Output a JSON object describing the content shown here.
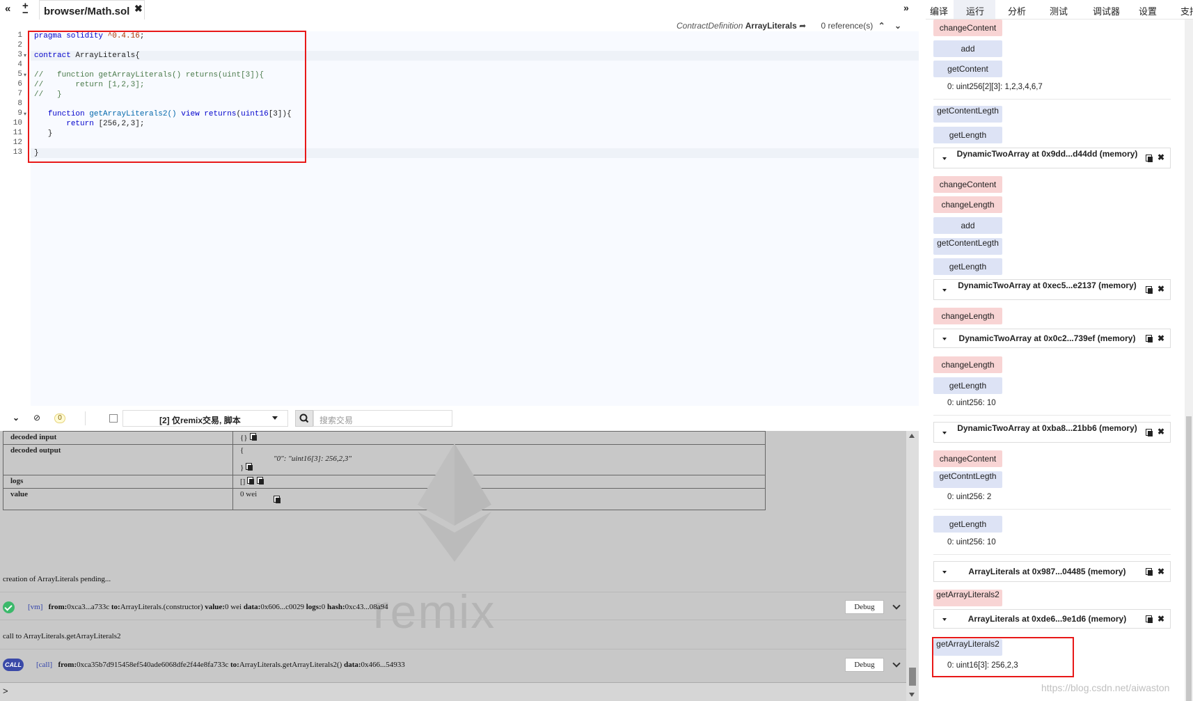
{
  "tabs": {
    "file_name": "browser/Math.sol"
  },
  "editor": {
    "ref_kind": "ContractDefinition",
    "ref_name": "ArrayLiterals",
    "ref_count": "0 reference(s)",
    "lines": [
      {
        "num": "1",
        "segments": [
          {
            "cls": "kw",
            "t": "pragma solidity "
          },
          {
            "cls": "str",
            "t": "^0.4.16"
          },
          {
            "cls": "",
            "t": ";"
          }
        ]
      },
      {
        "num": "2",
        "segments": []
      },
      {
        "num": "3",
        "segments": [
          {
            "cls": "kw",
            "t": "contract "
          },
          {
            "cls": "",
            "t": "ArrayLiterals{"
          }
        ]
      },
      {
        "num": "4",
        "segments": []
      },
      {
        "num": "5",
        "segments": [
          {
            "cls": "cm",
            "t": "//   function getArrayLiterals() returns(uint[3]){"
          }
        ]
      },
      {
        "num": "6",
        "segments": [
          {
            "cls": "cm",
            "t": "//       return [1,2,3];"
          }
        ]
      },
      {
        "num": "7",
        "segments": [
          {
            "cls": "cm",
            "t": "//   }"
          }
        ]
      },
      {
        "num": "8",
        "segments": []
      },
      {
        "num": "9",
        "segments": [
          {
            "cls": "",
            "t": "   "
          },
          {
            "cls": "kw",
            "t": "function "
          },
          {
            "cls": "fn",
            "t": "getArrayLiterals2() "
          },
          {
            "cls": "kw",
            "t": "view returns"
          },
          {
            "cls": "",
            "t": "("
          },
          {
            "cls": "kw",
            "t": "uint16"
          },
          {
            "cls": "",
            "t": "[3]){"
          }
        ]
      },
      {
        "num": "10",
        "segments": [
          {
            "cls": "",
            "t": "       "
          },
          {
            "cls": "kw",
            "t": "return "
          },
          {
            "cls": "",
            "t": "[256,2,3];"
          }
        ]
      },
      {
        "num": "11",
        "segments": [
          {
            "cls": "",
            "t": "   }"
          }
        ]
      },
      {
        "num": "12",
        "segments": []
      },
      {
        "num": "13",
        "segments": [
          {
            "cls": "",
            "t": "}"
          }
        ]
      }
    ]
  },
  "terminal": {
    "pending_count": "0",
    "filter_value": "[2] 仅remix交易, 脚本",
    "search_placeholder": "搜索交易",
    "table": {
      "decoded_input_key": "decoded input",
      "decoded_input_val": "{}",
      "decoded_output_key": "decoded output",
      "decoded_output_l1": "{",
      "decoded_output_l2": "\"0\": \"uint16[3]: 256,2,3\"",
      "decoded_output_l3": "}",
      "logs_key": "logs",
      "logs_val": "[]",
      "value_key": "value",
      "value_val": "0 wei"
    },
    "msg_pending": "creation of ArrayLiterals pending...",
    "tx1": {
      "tag": "[vm]",
      "from_k": "from:",
      "from_v": "0xca3...a733c",
      "to_k": "to:",
      "to_v": "ArrayLiterals.(constructor)",
      "value_k": "value:",
      "value_v": "0 wei",
      "data_k": "data:",
      "data_v": "0x606...c0029",
      "logs_k": "logs:",
      "logs_v": "0",
      "hash_k": "hash:",
      "hash_v": "0xc43...08a94"
    },
    "msg_call": "call to ArrayLiterals.getArrayLiterals2",
    "tx2": {
      "icon_label": "CALL",
      "tag": "[call]",
      "from_k": "from:",
      "from_v": "0xca35b7d915458ef540ade6068dfe2f44e8fa733c",
      "to_k": "to:",
      "to_v": "ArrayLiterals.getArrayLiterals2()",
      "data_k": "data:",
      "data_v": "0x466...54933"
    },
    "debug_label": "Debug",
    "watermark": "remix",
    "prompt": ">"
  },
  "right_panel": {
    "tabs": [
      "编译",
      "运行",
      "分析",
      "测试",
      "调试器",
      "设置",
      "支持"
    ],
    "active_tab": "运行",
    "btn_change_content": "changeContent",
    "btn_add": "add",
    "btn_get_content": "getContent",
    "btn_get_content_legth": "getContentLegth",
    "btn_get_length": "getLength",
    "btn_change_length": "changeLength",
    "btn_get_contnt_legth": "getContntLegth",
    "btn_get_array_literals": "getArrayLiterals2",
    "res_content": "0: uint256[2][3]: 1,2,3,4,6,7",
    "res_len_10": "0: uint256: 10",
    "res_len_2": "0: uint256: 2",
    "res_array": "0: uint16[3]: 256,2,3",
    "instances": [
      "DynamicTwoArray at 0x9dd...d44dd (memory)",
      "DynamicTwoArray at 0xec5...e2137 (memory)",
      "DynamicTwoArray at 0x0c2...739ef (memory)",
      "DynamicTwoArray at 0xba8...21bb6 (memory)",
      "ArrayLiterals at 0x987...04485 (memory)",
      "ArrayLiterals at 0xde6...9e1d6 (memory)"
    ],
    "watermark": "https://blog.csdn.net/aiwaston"
  }
}
